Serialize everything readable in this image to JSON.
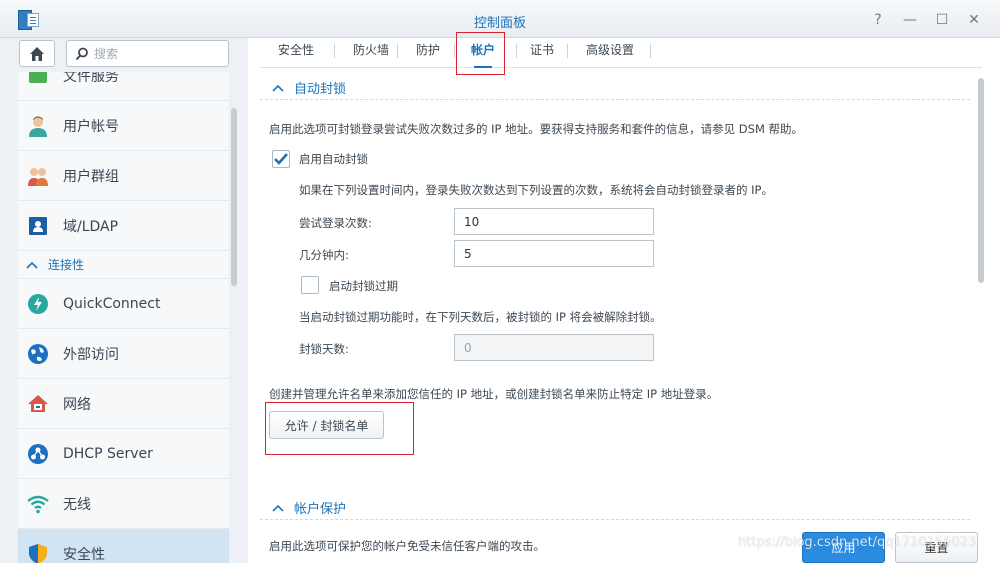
{
  "window": {
    "title": "控制面板",
    "controls": [
      "?",
      "—",
      "☐",
      "✕"
    ]
  },
  "sidebar": {
    "search_placeholder": "搜索",
    "partial_item": "文件服务",
    "items": [
      {
        "label": "用户帐号",
        "icon": "user-icon"
      },
      {
        "label": "用户群组",
        "icon": "group-icon"
      },
      {
        "label": "域/LDAP",
        "icon": "domain-ldap-icon"
      }
    ],
    "section": "连接性",
    "connectivity": [
      {
        "label": "QuickConnect",
        "icon": "quickconnect-icon"
      },
      {
        "label": "外部访问",
        "icon": "external-access-icon"
      },
      {
        "label": "网络",
        "icon": "network-icon"
      },
      {
        "label": "DHCP Server",
        "icon": "dhcp-icon"
      },
      {
        "label": "无线",
        "icon": "wireless-icon"
      },
      {
        "label": "安全性",
        "icon": "security-icon"
      }
    ]
  },
  "tabs": [
    "安全性",
    "防火墙",
    "防护",
    "帐户",
    "证书",
    "高级设置"
  ],
  "active_tab": "帐户",
  "auto_block": {
    "title": "自动封锁",
    "desc": "启用此选项可封锁登录尝试失败次数过多的 IP 地址。要获得支持服务和套件的信息，请参见 DSM 帮助。",
    "enable_label": "启用自动封锁",
    "enable_checked": true,
    "rule_desc": "如果在下列设置时间内，登录失败次数达到下列设置的次数，系统将会自动封锁登录者的 IP。",
    "attempts_label": "尝试登录次数:",
    "attempts_value": "10",
    "minutes_label": "几分钟内:",
    "minutes_value": "5",
    "expire_label": "启动封锁过期",
    "expire_checked": false,
    "expire_desc": "当启动封锁过期功能时，在下列天数后，被封锁的 IP 将会被解除封锁。",
    "days_label": "封锁天数:",
    "days_value": "0",
    "list_desc": "创建并管理允许名单来添加您信任的 IP 地址，或创建封锁名单来防止特定 IP 地址登录。",
    "list_button": "允许 / 封锁名单"
  },
  "account_protection": {
    "title": "帐户保护",
    "desc": "启用此选项可保护您的帐户免受未信任客户端的攻击。"
  },
  "footer": {
    "apply": "应用",
    "reset": "重置"
  },
  "watermark": "https://blog.csdn.net/qq1710156023",
  "colors": {
    "accent": "#1d73b8",
    "primary_button": "#2a8be0",
    "highlight_box": "#d9232e"
  }
}
